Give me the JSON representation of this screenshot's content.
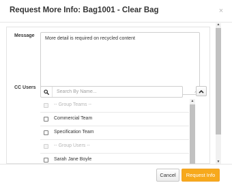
{
  "dialog": {
    "title": "Request More Info: Bag1001 - Clear Bag",
    "close_glyph": "×"
  },
  "form": {
    "message_label": "Message",
    "message_value": "More detail is required on recycled content",
    "cc_label": "CC Users",
    "search_placeholder": "Search By Name..."
  },
  "cc_list": {
    "items": [
      {
        "label": "-- Group Teams --",
        "type": "group-header"
      },
      {
        "label": "Commercial Team",
        "type": "option",
        "checked": false
      },
      {
        "label": "Specification Team",
        "type": "option",
        "checked": false
      },
      {
        "label": "-- Group Users --",
        "type": "group-header"
      },
      {
        "label": "Sarah Jane Boyle",
        "type": "option",
        "checked": false
      }
    ]
  },
  "footer": {
    "cancel_label": "Cancel",
    "request_label": "Request Info"
  },
  "icons": {
    "search": "search-icon",
    "collapse": "chevron-up-icon",
    "close": "close-icon"
  },
  "colors": {
    "primary_button": "#f7a91c",
    "primary_button_text": "#ffffff"
  }
}
